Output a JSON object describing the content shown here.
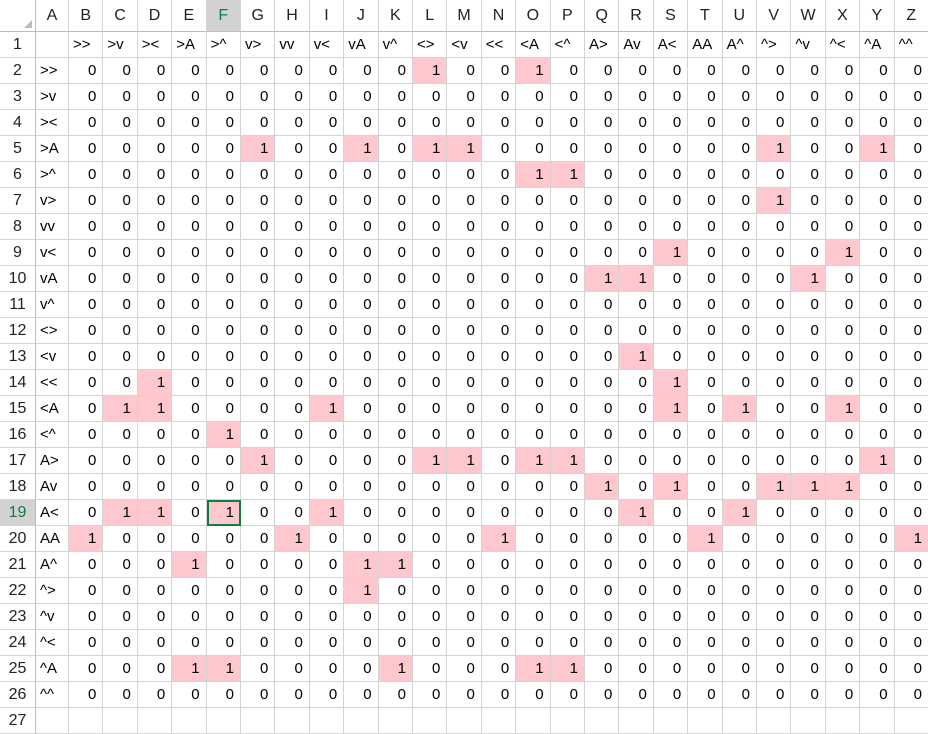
{
  "columns": [
    "A",
    "B",
    "C",
    "D",
    "E",
    "F",
    "G",
    "H",
    "I",
    "J",
    "K",
    "L",
    "M",
    "N",
    "O",
    "P",
    "Q",
    "R",
    "S",
    "T",
    "U",
    "V",
    "W",
    "X",
    "Y",
    "Z"
  ],
  "row_numbers": [
    "1",
    "2",
    "3",
    "4",
    "5",
    "6",
    "7",
    "8",
    "9",
    "10",
    "11",
    "12",
    "13",
    "14",
    "15",
    "16",
    "17",
    "18",
    "19",
    "20",
    "21",
    "22",
    "23",
    "24",
    "25",
    "26",
    "27"
  ],
  "active_cell": {
    "row": 19,
    "col": "F"
  },
  "highlight_color": "#ffc7ce",
  "header_row": [
    "",
    ">>",
    ">v",
    "><",
    ">A",
    ">^",
    "v>",
    "vv",
    "v<",
    "vA",
    "v^",
    "<>",
    "<v",
    "<<",
    "<A",
    "<^",
    "A>",
    "Av",
    "A<",
    "AA",
    "A^",
    "^>",
    "^v",
    "^<",
    "^A",
    "^^"
  ],
  "row_labels": [
    ">>",
    ">v",
    "><",
    ">A",
    ">^",
    "v>",
    "vv",
    "v<",
    "vA",
    "v^",
    "<>",
    "<v",
    "<<",
    "<A",
    "<^",
    "A>",
    "Av",
    "A<",
    "AA",
    "A^",
    "^>",
    "^v",
    "^<",
    "^A",
    "^^"
  ],
  "matrix": [
    [
      0,
      0,
      0,
      0,
      0,
      0,
      0,
      0,
      0,
      0,
      1,
      0,
      0,
      1,
      0,
      0,
      0,
      0,
      0,
      0,
      0,
      0,
      0,
      0,
      0
    ],
    [
      0,
      0,
      0,
      0,
      0,
      0,
      0,
      0,
      0,
      0,
      0,
      0,
      0,
      0,
      0,
      0,
      0,
      0,
      0,
      0,
      0,
      0,
      0,
      0,
      0
    ],
    [
      0,
      0,
      0,
      0,
      0,
      0,
      0,
      0,
      0,
      0,
      0,
      0,
      0,
      0,
      0,
      0,
      0,
      0,
      0,
      0,
      0,
      0,
      0,
      0,
      0
    ],
    [
      0,
      0,
      0,
      0,
      0,
      1,
      0,
      0,
      1,
      0,
      1,
      1,
      0,
      0,
      0,
      0,
      0,
      0,
      0,
      0,
      1,
      0,
      0,
      1,
      0
    ],
    [
      0,
      0,
      0,
      0,
      0,
      0,
      0,
      0,
      0,
      0,
      0,
      0,
      0,
      1,
      1,
      0,
      0,
      0,
      0,
      0,
      0,
      0,
      0,
      0,
      0
    ],
    [
      0,
      0,
      0,
      0,
      0,
      0,
      0,
      0,
      0,
      0,
      0,
      0,
      0,
      0,
      0,
      0,
      0,
      0,
      0,
      0,
      1,
      0,
      0,
      0,
      0
    ],
    [
      0,
      0,
      0,
      0,
      0,
      0,
      0,
      0,
      0,
      0,
      0,
      0,
      0,
      0,
      0,
      0,
      0,
      0,
      0,
      0,
      0,
      0,
      0,
      0,
      0
    ],
    [
      0,
      0,
      0,
      0,
      0,
      0,
      0,
      0,
      0,
      0,
      0,
      0,
      0,
      0,
      0,
      0,
      0,
      1,
      0,
      0,
      0,
      0,
      1,
      0,
      0
    ],
    [
      0,
      0,
      0,
      0,
      0,
      0,
      0,
      0,
      0,
      0,
      0,
      0,
      0,
      0,
      0,
      1,
      1,
      0,
      0,
      0,
      0,
      1,
      0,
      0,
      0
    ],
    [
      0,
      0,
      0,
      0,
      0,
      0,
      0,
      0,
      0,
      0,
      0,
      0,
      0,
      0,
      0,
      0,
      0,
      0,
      0,
      0,
      0,
      0,
      0,
      0,
      0
    ],
    [
      0,
      0,
      0,
      0,
      0,
      0,
      0,
      0,
      0,
      0,
      0,
      0,
      0,
      0,
      0,
      0,
      0,
      0,
      0,
      0,
      0,
      0,
      0,
      0,
      0
    ],
    [
      0,
      0,
      0,
      0,
      0,
      0,
      0,
      0,
      0,
      0,
      0,
      0,
      0,
      0,
      0,
      0,
      1,
      0,
      0,
      0,
      0,
      0,
      0,
      0,
      0
    ],
    [
      0,
      0,
      1,
      0,
      0,
      0,
      0,
      0,
      0,
      0,
      0,
      0,
      0,
      0,
      0,
      0,
      0,
      1,
      0,
      0,
      0,
      0,
      0,
      0,
      0
    ],
    [
      0,
      1,
      1,
      0,
      0,
      0,
      0,
      1,
      0,
      0,
      0,
      0,
      0,
      0,
      0,
      0,
      0,
      1,
      0,
      1,
      0,
      0,
      1,
      0,
      0
    ],
    [
      0,
      0,
      0,
      0,
      1,
      0,
      0,
      0,
      0,
      0,
      0,
      0,
      0,
      0,
      0,
      0,
      0,
      0,
      0,
      0,
      0,
      0,
      0,
      0,
      0
    ],
    [
      0,
      0,
      0,
      0,
      0,
      1,
      0,
      0,
      0,
      0,
      1,
      1,
      0,
      1,
      1,
      0,
      0,
      0,
      0,
      0,
      0,
      0,
      0,
      1,
      0
    ],
    [
      0,
      0,
      0,
      0,
      0,
      0,
      0,
      0,
      0,
      0,
      0,
      0,
      0,
      0,
      0,
      1,
      0,
      1,
      0,
      0,
      1,
      1,
      1,
      0,
      0
    ],
    [
      0,
      1,
      1,
      0,
      1,
      0,
      0,
      1,
      0,
      0,
      0,
      0,
      0,
      0,
      0,
      0,
      1,
      0,
      0,
      1,
      0,
      0,
      0,
      0,
      0
    ],
    [
      1,
      0,
      0,
      0,
      0,
      0,
      1,
      0,
      0,
      0,
      0,
      0,
      1,
      0,
      0,
      0,
      0,
      0,
      1,
      0,
      0,
      0,
      0,
      0,
      1
    ],
    [
      0,
      0,
      0,
      1,
      0,
      0,
      0,
      0,
      1,
      1,
      0,
      0,
      0,
      0,
      0,
      0,
      0,
      0,
      0,
      0,
      0,
      0,
      0,
      0,
      0
    ],
    [
      0,
      0,
      0,
      0,
      0,
      0,
      0,
      0,
      1,
      0,
      0,
      0,
      0,
      0,
      0,
      0,
      0,
      0,
      0,
      0,
      0,
      0,
      0,
      0,
      0
    ],
    [
      0,
      0,
      0,
      0,
      0,
      0,
      0,
      0,
      0,
      0,
      0,
      0,
      0,
      0,
      0,
      0,
      0,
      0,
      0,
      0,
      0,
      0,
      0,
      0,
      0
    ],
    [
      0,
      0,
      0,
      0,
      0,
      0,
      0,
      0,
      0,
      0,
      0,
      0,
      0,
      0,
      0,
      0,
      0,
      0,
      0,
      0,
      0,
      0,
      0,
      0,
      0
    ],
    [
      0,
      0,
      0,
      1,
      1,
      0,
      0,
      0,
      0,
      1,
      0,
      0,
      0,
      1,
      1,
      0,
      0,
      0,
      0,
      0,
      0,
      0,
      0,
      0,
      0
    ],
    [
      0,
      0,
      0,
      0,
      0,
      0,
      0,
      0,
      0,
      0,
      0,
      0,
      0,
      0,
      0,
      0,
      0,
      0,
      0,
      0,
      0,
      0,
      0,
      0,
      0
    ]
  ]
}
